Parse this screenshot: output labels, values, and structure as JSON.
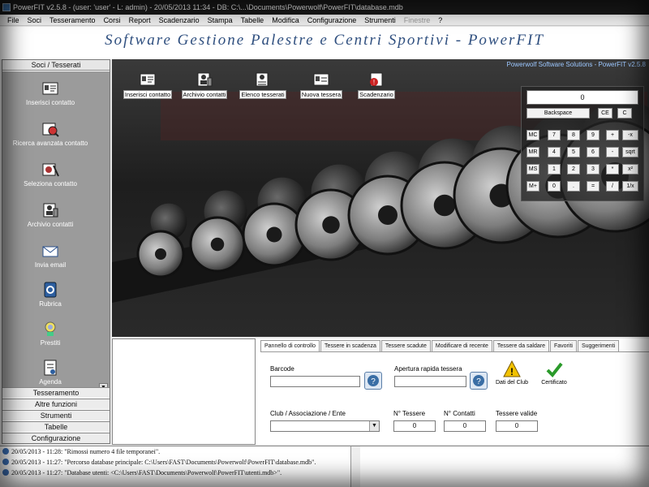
{
  "window": {
    "title": "PowerFIT v2.5.8 - (user: 'user' - L: admin) - 20/05/2013 11:34 - DB: C:\\...\\Documents\\Powerwolf\\PowerFIT\\database.mdb"
  },
  "menu": [
    {
      "label": "File",
      "enabled": true
    },
    {
      "label": "Soci",
      "enabled": true
    },
    {
      "label": "Tesseramento",
      "enabled": true
    },
    {
      "label": "Corsi",
      "enabled": true
    },
    {
      "label": "Report",
      "enabled": true
    },
    {
      "label": "Scadenzario",
      "enabled": true
    },
    {
      "label": "Stampa",
      "enabled": true
    },
    {
      "label": "Tabelle",
      "enabled": true
    },
    {
      "label": "Modifica",
      "enabled": true
    },
    {
      "label": "Configurazione",
      "enabled": true
    },
    {
      "label": "Strumenti",
      "enabled": true
    },
    {
      "label": "Finestre",
      "enabled": false
    },
    {
      "label": "?",
      "enabled": true
    }
  ],
  "header": {
    "title": "Software Gestione Palestre e Centri Sportivi - PowerFIT"
  },
  "sidebar": {
    "title": "Soci / Tesserati",
    "items": [
      {
        "label": "Inserisci contatto",
        "icon": "contact-card-icon"
      },
      {
        "label": "Ricerca avanzata contatto",
        "icon": "search-contact-icon"
      },
      {
        "label": "Seleziona contatto",
        "icon": "select-contact-icon"
      },
      {
        "label": "Archivio contatti",
        "icon": "contact-archive-icon"
      },
      {
        "label": "Invia email",
        "icon": "email-icon"
      },
      {
        "label": "Rubrica",
        "icon": "address-book-icon"
      },
      {
        "label": "Prestiti",
        "icon": "loans-icon"
      },
      {
        "label": "Agenda",
        "icon": "agenda-icon"
      }
    ],
    "sections": [
      "Tesseramento",
      "Altre funzioni",
      "Strumenti",
      "Tabelle",
      "Configurazione"
    ]
  },
  "main": {
    "credits": "Powerwolf Software Solutions - PowerFIT v2.5.8",
    "quick": [
      {
        "label": "Inserisci contatto",
        "icon": "contact-card-icon"
      },
      {
        "label": "Archivio contatti",
        "icon": "contact-archive-icon"
      },
      {
        "label": "Elenco tesserati",
        "icon": "members-list-icon"
      },
      {
        "label": "Nuova tessera",
        "icon": "new-card-icon"
      },
      {
        "label": "Scadenzario",
        "icon": "deadlines-icon"
      }
    ]
  },
  "calculator": {
    "display": "0",
    "top_buttons": [
      "Backspace",
      "CE",
      "C"
    ],
    "rows": [
      [
        "MC",
        "7",
        "8",
        "9",
        "+",
        "-x"
      ],
      [
        "MR",
        "4",
        "5",
        "6",
        "-",
        "sqrt"
      ],
      [
        "MS",
        "1",
        "2",
        "3",
        "*",
        "x²"
      ],
      [
        "M+",
        "0",
        ".",
        "=",
        "/",
        "1/x"
      ]
    ]
  },
  "tabs": [
    "Pannello di controllo",
    "Tessere in scadenza",
    "Tessere scadute",
    "Modificare di recente",
    "Tessere da saldare",
    "Favoriti",
    "Suggerimenti"
  ],
  "control_panel": {
    "barcode_label": "Barcode",
    "barcode_value": "",
    "quick_open_label": "Apertura rapida tessera",
    "quick_open_value": "",
    "club_data_label": "Dati del Club",
    "certificate_label": "Certificato",
    "club_label": "Club / Associazione / Ente",
    "club_value": "",
    "n_tessere_label": "N° Tessere",
    "n_tessere_value": "0",
    "n_contatti_label": "N° Contatti",
    "n_contatti_value": "0",
    "tessere_valide_label": "Tessere valide",
    "tessere_valide_value": "0"
  },
  "log": [
    "20/05/2013 - 11:28: \"Rimossi numero 4 file temporanei\".",
    "20/05/2013 - 11:27: \"Percorso database principale: C:\\Users\\FAST\\Documents\\Powerwolf\\PowerFIT\\database.mdb\".",
    "20/05/2013 - 11:27: \"Database utenti: <C:\\Users\\FAST\\Documents\\Powerwolf\\PowerFIT\\utenti.mdb>\"."
  ]
}
